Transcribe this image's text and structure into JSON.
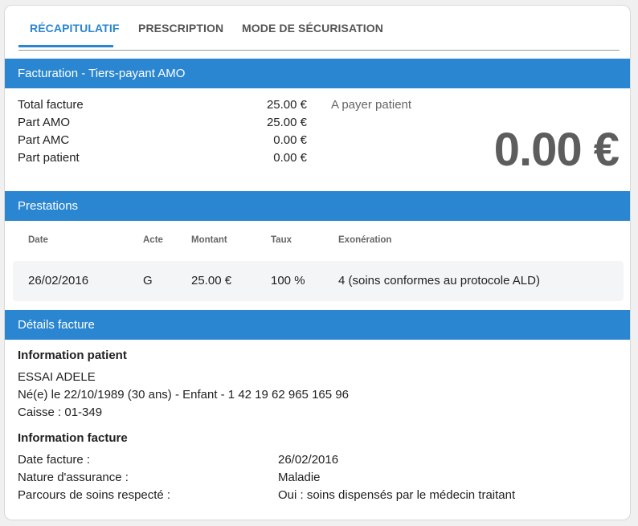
{
  "tabs": [
    {
      "label": "RÉCAPITULATIF",
      "active": true
    },
    {
      "label": "PRESCRIPTION",
      "active": false
    },
    {
      "label": "MODE DE SÉCURISATION",
      "active": false
    }
  ],
  "colors": {
    "accent": "#2a86d0",
    "amount": "#5d5d5d"
  },
  "facturation": {
    "title": "Facturation - Tiers-payant AMO",
    "rows": [
      {
        "label": "Total facture",
        "value": "25.00 €"
      },
      {
        "label": "Part AMO",
        "value": "25.00 €"
      },
      {
        "label": "Part AMC",
        "value": "0.00 €"
      },
      {
        "label": "Part patient",
        "value": "0.00 €"
      }
    ],
    "payer_label": "A payer patient",
    "payer_amount": "0.00 €"
  },
  "prestations": {
    "title": "Prestations",
    "headers": {
      "date": "Date",
      "acte": "Acte",
      "montant": "Montant",
      "taux": "Taux",
      "exoneration": "Exonération"
    },
    "rows": [
      {
        "date": "26/02/2016",
        "acte": "G",
        "montant": "25.00 €",
        "taux": "100 %",
        "exoneration": "4 (soins conformes au protocole ALD)"
      }
    ]
  },
  "details": {
    "title": "Détails facture",
    "patient": {
      "heading": "Information patient",
      "name": "ESSAI ADELE",
      "birth": "Né(e) le 22/10/1989 (30 ans) - Enfant - 1 42 19 62 965 165 96",
      "caisse": "Caisse : 01-349"
    },
    "facture": {
      "heading": "Information facture",
      "rows": [
        {
          "label": "Date facture :",
          "value": "26/02/2016"
        },
        {
          "label": "Nature d'assurance :",
          "value": "Maladie"
        },
        {
          "label": "Parcours de soins respecté :",
          "value": "Oui : soins dispensés par le médecin traitant"
        }
      ]
    }
  }
}
